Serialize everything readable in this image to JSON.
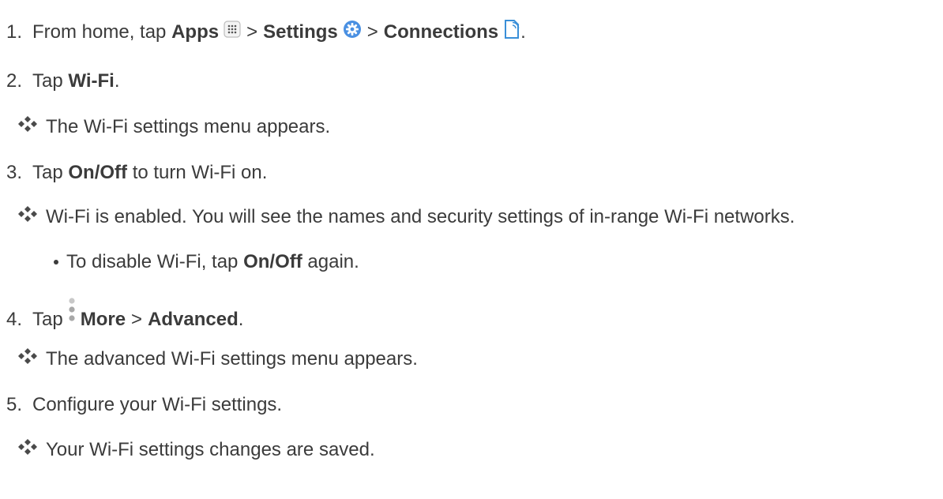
{
  "steps": [
    {
      "number": "1.",
      "pre": "From home, tap",
      "apps": "Apps",
      "gt1": ">",
      "settings": "Settings",
      "gt2": ">",
      "connections": "Connections",
      "end": "."
    },
    {
      "number": "2.",
      "pre": "Tap",
      "bold": "Wi-Fi",
      "end": "."
    },
    {
      "result": "The Wi-Fi settings menu appears."
    },
    {
      "number": "3.",
      "pre": "Tap",
      "bold": "On/Off",
      "post": "to turn Wi-Fi on."
    },
    {
      "result": "Wi-Fi is enabled. You will see the names and security settings of in-range Wi-Fi networks."
    },
    {
      "pre": "To disable Wi-Fi, tap",
      "bold": "On/Off",
      "post": "again."
    },
    {
      "number": "4.",
      "pre": "Tap",
      "more": "More",
      "gt": ">",
      "advanced": "Advanced",
      "end": "."
    },
    {
      "result": "The advanced Wi-Fi settings menu appears."
    },
    {
      "number": "5.",
      "text": "Configure your Wi-Fi settings."
    },
    {
      "result": "Your Wi-Fi settings changes are saved."
    }
  ],
  "icons": {
    "apps": "apps-grid-icon",
    "settings": "settings-gear-icon",
    "connections": "connections-icon",
    "result": "result-diamond-icon",
    "more": "more-vertical-dots-icon"
  },
  "colors": {
    "text": "#3b3b3b",
    "settings_icon": "#4a90e2",
    "connections_icon": "#3a8fd8"
  }
}
